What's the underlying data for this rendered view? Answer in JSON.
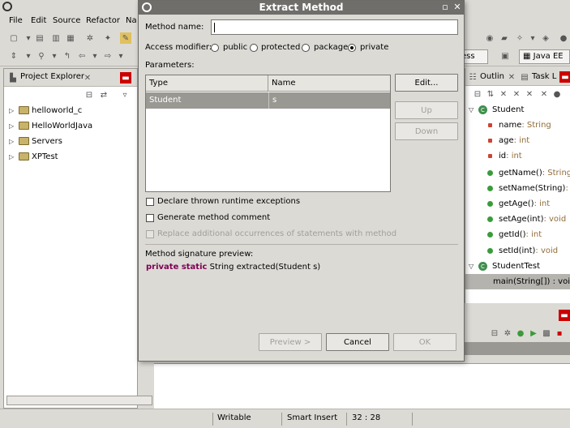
{
  "menubar": {
    "items": [
      "File",
      "Edit",
      "Source",
      "Refactor",
      "Na"
    ]
  },
  "perspectives": {
    "access": "ess",
    "java_ee": "Java EE"
  },
  "project_explorer": {
    "title": "Project Explorer",
    "projects": [
      "helloworld_c",
      "HelloWorldJava",
      "Servers",
      "XPTest"
    ]
  },
  "outline": {
    "tab_outline": "Outlin",
    "tab_task": "Task L",
    "class_student": "Student",
    "fields": [
      {
        "name": "name",
        "type": " : String"
      },
      {
        "name": "age",
        "type": " : int"
      },
      {
        "name": "id",
        "type": " : int"
      }
    ],
    "methods": [
      {
        "name": "getName()",
        "type": " : String"
      },
      {
        "name": "setName(String)",
        "type": " : v"
      },
      {
        "name": "getAge()",
        "type": " : int"
      },
      {
        "name": "setAge(int)",
        "type": " : void"
      },
      {
        "name": "getId()",
        "type": " : int"
      },
      {
        "name": "setId(int)",
        "type": " : void"
      }
    ],
    "class_studenttest": "StudentTest",
    "main_method": "main(String[]) : void"
  },
  "statusbar": {
    "writable": "Writable",
    "insert_mode": "Smart Insert",
    "position": "32 : 28"
  },
  "dialog": {
    "title": "Extract Method",
    "method_name_label": "Method name:",
    "method_name_value": "",
    "access_label": "Access modifier:",
    "access_options": [
      "public",
      "protected",
      "package",
      "private"
    ],
    "access_selected": "private",
    "parameters_label": "Parameters:",
    "columns": [
      "Type",
      "Name"
    ],
    "rows": [
      {
        "type": "Student",
        "name": "s"
      }
    ],
    "edit_btn": "Edit...",
    "up_btn": "Up",
    "down_btn": "Down",
    "check_declare": "Declare thrown runtime exceptions",
    "check_comment": "Generate method comment",
    "check_replace": "Replace additional occurrences of statements with method",
    "signature_label": "Method signature preview:",
    "signature_kw": "private static",
    "signature_rest": " String extracted(Student s)",
    "preview_btn": "Preview >",
    "cancel_btn": "Cancel",
    "ok_btn": "OK"
  },
  "colors": {
    "titlebar": "#6f6e6b",
    "selection": "#9a9893",
    "keyword": "#7f0055"
  }
}
